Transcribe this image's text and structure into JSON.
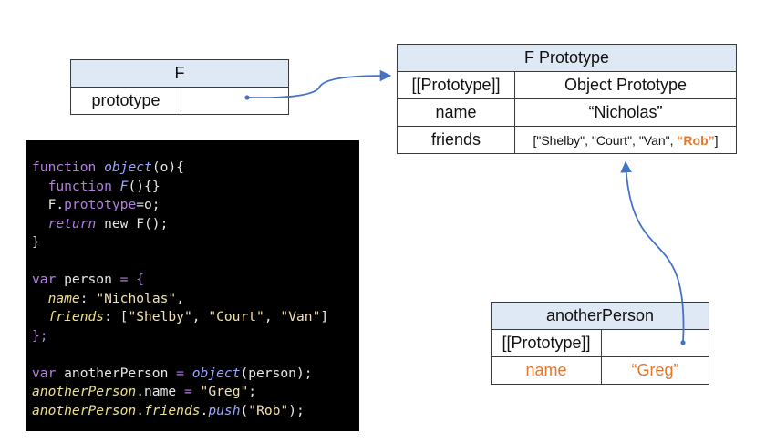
{
  "f_box": {
    "title": "F",
    "row_label": "prototype"
  },
  "f_prototype_box": {
    "title": "F Prototype",
    "rows": [
      {
        "key": "[[Prototype]]",
        "value": "Object Prototype"
      },
      {
        "key": "name",
        "value": "“Nicholas”"
      },
      {
        "key": "friends",
        "value_prefix": "[\"Shelby\", \"Court\", \"Van\", ",
        "value_highlight": "“Rob”",
        "value_suffix": "]"
      }
    ]
  },
  "another_person_box": {
    "title": "anotherPerson",
    "rows": [
      {
        "key": "[[Prototype]]",
        "value": ""
      },
      {
        "key": "name",
        "value": "“Greg”"
      }
    ]
  },
  "code": {
    "l1": {
      "kw": "function",
      "fn": "object",
      "rest": "(o){"
    },
    "l2": {
      "indent": "  ",
      "kw": "function",
      "fn": "F",
      "rest": "(){}"
    },
    "l3": {
      "indent": "  ",
      "obj": "F.",
      "prop": "prototype",
      "rest": "=o;"
    },
    "l4": {
      "indent": "  ",
      "kw": "return",
      "mid": " new ",
      "rest": "F();"
    },
    "l5": "}",
    "l7": {
      "kw": "var",
      "mid": " person ",
      "op": "=",
      "rest": " {"
    },
    "l8": {
      "indent": "  ",
      "prop": "name",
      "mid": ": ",
      "str": "\"Nicholas\"",
      "rest": ","
    },
    "l9": {
      "indent": "  ",
      "prop": "friends",
      "mid": ": [",
      "s1": "\"Shelby\"",
      "c1": ", ",
      "s2": "\"Court\"",
      "c2": ", ",
      "s3": "\"Van\"",
      "rest": "]"
    },
    "l10": "};",
    "l12": {
      "kw": "var",
      "mid": " anotherPerson ",
      "op": "=",
      "sp": " ",
      "fn": "object",
      "rest": "(person);"
    },
    "l13": {
      "obj": "anotherPerson",
      "mid": ".name ",
      "op": "=",
      "sp": " ",
      "str": "\"Greg\"",
      "rest": ";"
    },
    "l14": {
      "obj": "anotherPerson",
      "dot1": ".",
      "prop": "friends",
      "dot2": ".",
      "fn": "push",
      "open": "(",
      "str": "\"Rob\"",
      "rest": ");"
    }
  },
  "colors": {
    "header_fill": "#dfe8f5",
    "arrow": "#4472c4",
    "highlight": "#e2782f",
    "code_bg": "#000000"
  }
}
